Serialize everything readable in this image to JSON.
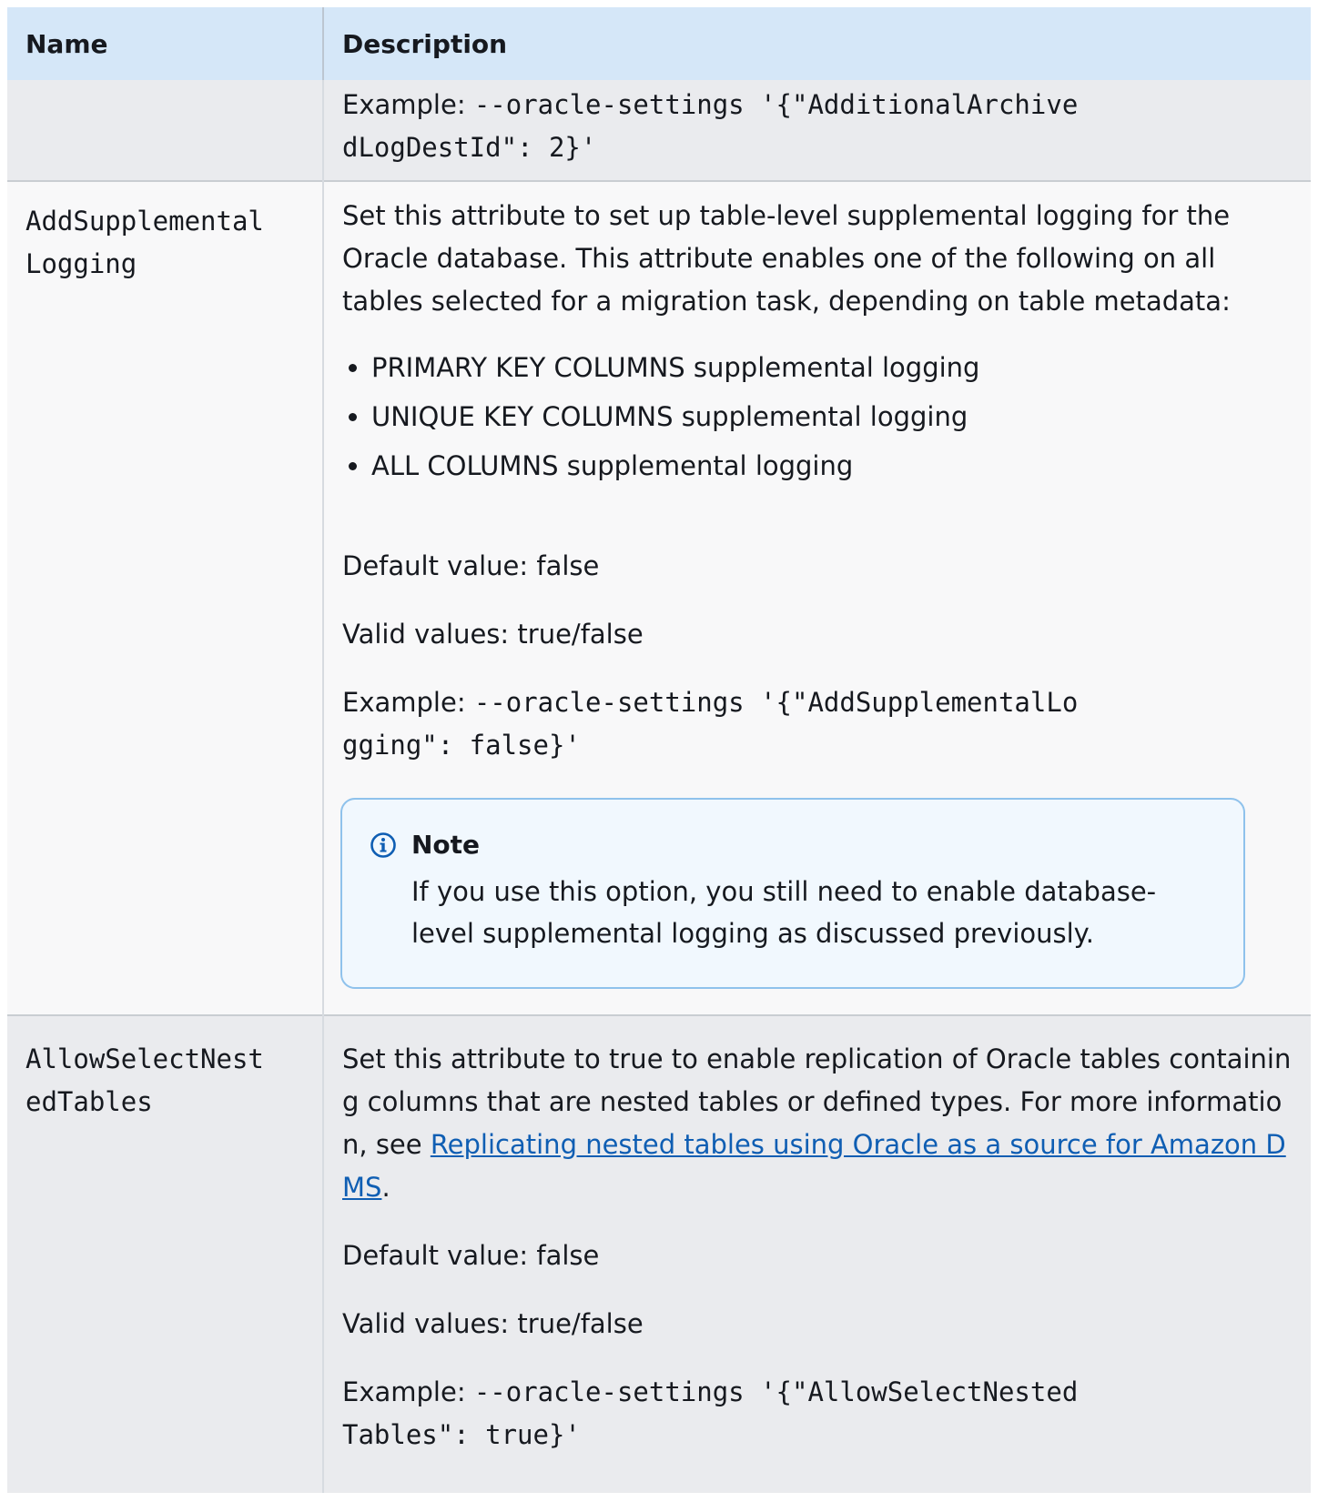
{
  "table": {
    "headers": {
      "name": "Name",
      "description": "Description"
    },
    "row1": {
      "example_prefix": "Example: ",
      "example_code": "--oracle-settings '{\"AdditionalArchivedLogDestId\": 2}'"
    },
    "row2": {
      "name": "AddSupplementalLogging",
      "desc1": "Set this attribute to set up table-level supplemental logging for the Oracle database. This attribute enables one of the following on all tables selected for a migration task, depending on table metadata:",
      "bullets": [
        "PRIMARY KEY COLUMNS supplemental logging",
        "UNIQUE KEY COLUMNS supplemental logging",
        "ALL COLUMNS supplemental logging"
      ],
      "default": "Default value: false",
      "valid": "Valid values: true/false",
      "example_prefix": "Example: ",
      "example_code": "--oracle-settings '{\"AddSupplementalLogging\": false}'",
      "note": {
        "title": "Note",
        "body": "If you use this option, you still need to enable database-level supplemental logging as discussed previously."
      }
    },
    "row3": {
      "name": "AllowSelectNestedTables",
      "desc_before_link": "Set this attribute to true to enable replication of Oracle tables containing columns that are nested tables or defined types. For more information, see ",
      "link": "Replicating nested tables using Oracle as a source for Amazon DMS",
      "desc_after_link": ".",
      "default": "Default value: false",
      "valid": "Valid values: true/false",
      "example_prefix": "Example: ",
      "example_code": "--oracle-settings '{\"AllowSelectNestedTables\": true}'"
    }
  },
  "colors": {
    "header_bg": "#d5e7f8",
    "row_grey": "#eaebee",
    "row_light": "#f8f8f9",
    "link": "#0f5eb3",
    "note_border": "#8fc2ec",
    "note_bg": "#f1f8fe",
    "info_icon": "#0f5eb3"
  },
  "icons": {
    "note": "info-circle-icon"
  }
}
